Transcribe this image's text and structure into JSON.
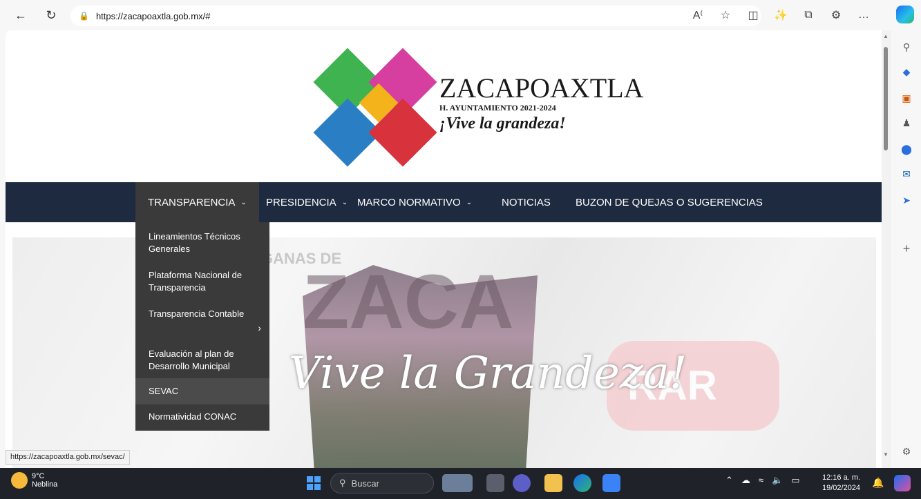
{
  "browser": {
    "url": "https://zacapoaxtla.gob.mx/#",
    "status_url": "https://zacapoaxtla.gob.mx/sevac/"
  },
  "site": {
    "title": "ZACAPOAXTLA",
    "subtitle": "H. AYUNTAMIENTO 2021-2024",
    "slogan": "¡Vive la grandeza!"
  },
  "nav": {
    "items": [
      {
        "label": "TRANSPARENCIA",
        "has_dropdown": true,
        "active": true
      },
      {
        "label": "PRESIDENCIA",
        "has_dropdown": true
      },
      {
        "label": "MARCO NORMATIVO",
        "has_dropdown": true
      },
      {
        "label": "NOTICIAS",
        "has_dropdown": false
      },
      {
        "label": "BUZON DE QUEJAS O SUGERENCIAS",
        "has_dropdown": false
      }
    ]
  },
  "dropdown": {
    "items": [
      {
        "label": "Lineamientos Técnicos Generales"
      },
      {
        "label": "Plataforma Nacional de Transparencia"
      },
      {
        "label": "Transparencia Contable",
        "has_submenu": true
      },
      {
        "label": "Evaluación al plan de Desarrollo Municipal"
      },
      {
        "label": "SEVAC",
        "hover": true
      },
      {
        "label": "Normatividad CONAC"
      }
    ]
  },
  "hero": {
    "ghost_text": "GANAS DE",
    "big_text": "ZACA",
    "script_text": "Vive la Grandeza!",
    "pink_text": "RAR"
  },
  "taskbar": {
    "weather_temp": "9°C",
    "weather_desc": "Neblina",
    "search_placeholder": "Buscar",
    "time": "12:16 a. m.",
    "date": "19/02/2024"
  },
  "colors": {
    "nav_bg": "#1d2a3f",
    "dropdown_bg": "#3a3a3a",
    "logo_green": "#3fb34f",
    "logo_magenta": "#d63fa0",
    "logo_yellow": "#f4b31a",
    "logo_blue": "#2a7fc4",
    "logo_red": "#d8323c"
  }
}
